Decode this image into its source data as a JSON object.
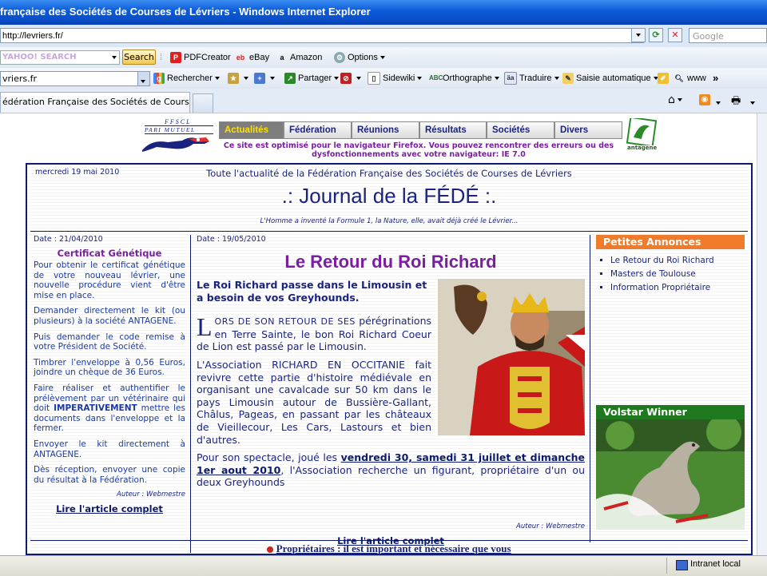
{
  "window": {
    "title": "française des Sociétés de Courses de Lévriers - Windows Internet Explorer"
  },
  "address": {
    "url": "http://levriers.fr/",
    "prefix": "",
    "search_placeholder": "Google"
  },
  "toolbar1": {
    "yahoo_placeholder": "YAHOO! SEARCH",
    "search_label": "Search",
    "pdfcreator": "PDFCreator",
    "ebay": "eBay",
    "amazon": "Amazon",
    "options": "Options"
  },
  "toolbar2": {
    "combo_value": "vriers.fr",
    "rechercher": "Rechercher",
    "partager": "Partager",
    "sidewiki": "Sidewiki",
    "orthographe": "Orthographe",
    "traduire": "Traduire",
    "saisie": "Saisie automatique",
    "www": "www",
    "more": "»"
  },
  "tabs": {
    "active_title": "édération Française des Sociétés de Courses de Lév..."
  },
  "site": {
    "logo_text1": "FFSCL",
    "logo_text2": "PARI MUTUEL",
    "nav": [
      "Actualités",
      "Fédération",
      "Réunions",
      "Résultats",
      "Sociétés",
      "Divers"
    ],
    "optimise_line1": "Ce site est optimisé pour le navigateur Firefox. Vous pouvez rencontrer des erreurs ou des",
    "optimise_line2": "dysfonctionnements avec votre navigateur: IE 7.0",
    "antagene": "antagene"
  },
  "journal": {
    "date": "mercredi 19 mai 2010",
    "subtitle": "Toute l'actualité de la Fédération Française des Sociétés de Courses de Lévriers",
    "title": ".: Journal de la FÉDÉ :.",
    "quote": "L'Homme a inventé la Formule 1, la Nature, elle, avait déjà créé le Lévrier..."
  },
  "left_col": {
    "date": "Date : 21/04/2010",
    "heading": "Certificat Génétique",
    "paragraphs": [
      "Pour obtenir le certificat génétique de votre nouveau lévrier, une nouvelle procédure vient d'être mise en place.",
      "Demander directement le kit (ou plusieurs) à la société ANTAGENE.",
      "Puis demander le code remise à votre Président de Société.",
      "Timbrer l'enveloppe à 0,56 Euros, joindre un chèque de 36 Euros."
    ],
    "p5_a": "Faire réaliser et authentifier le prélèvement par un vétérinaire qui doit ",
    "p5_bold": "IMPERATIVEMENT",
    "p5_b": " mettre les documents dans l'enveloppe et la fermer.",
    "p6": "Envoyer le kit directement à ANTAGENE.",
    "p7": "Dès réception, envoyer une copie du résultat à la Fédération.",
    "author": "Auteur : Webmestre",
    "read_more": "Lire l'article complet"
  },
  "main_col": {
    "date": "Date : 19/05/2010",
    "title": "Le Retour du Roi Richard",
    "lead": "Le Roi Richard passe dans le Limousin et a besoin de vos Greyhounds.",
    "dropcap": "L",
    "p1_caps": "ORS DE SON RETOUR DE SES",
    "p1_rest": "pérégrinations en Terre Sainte, le bon Roi Richard Coeur de Lion est passé par le Limousin.",
    "p2": "L'Association RICHARD EN OCCITANIE fait revivre cette partie d'histoire médiévale en organisant une cavalcade sur 50 km dans le pays Limousin autour de Bussière-Gallant, Châlus, Pageas, en passant par les châteaux de Vieillecour, Les Cars, Lastours et bien d'autres.",
    "p3_a": "Pour son spectacle, joué les ",
    "p3_link": "vendredi 30, samedi 31 juillet et dimanche 1er aout 2010",
    "p3_b": ", l'Association recherche un figurant, propriétaire d'un ou deux Greyhounds",
    "author": "Auteur : Webmestre",
    "read_more": "Lire l'article complet"
  },
  "right_col": {
    "announcements_title": "Petites Annonces",
    "announcements": [
      "Le Retour du Roi Richard",
      "Masters de Toulouse",
      "Information Propriétaire"
    ],
    "winner_title": "Volstar Winner"
  },
  "bottom": {
    "link": "Propriétaires : il est important et nécessaire que vous"
  },
  "status": {
    "zone": "Intranet local"
  },
  "colors": {
    "navy": "#1a237e",
    "purple": "#7b1fa2",
    "orange": "#f07b2a",
    "green": "#1f7a1f",
    "ie_blue": "#0a5ad8"
  }
}
